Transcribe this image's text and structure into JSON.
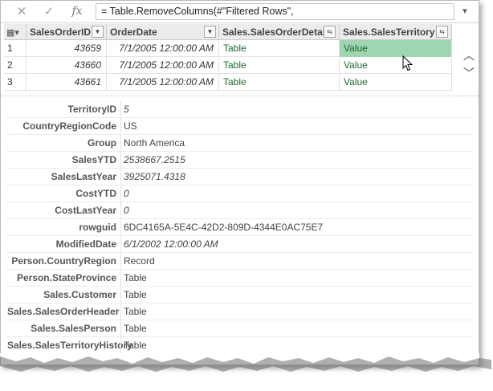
{
  "formula_bar": {
    "cancel_icon": "close-icon",
    "commit_icon": "check-icon",
    "fx_label": "fx",
    "formula": "= Table.RemoveColumns(#\"Filtered Rows\","
  },
  "grid": {
    "columns": [
      "SalesOrderID",
      "OrderDate",
      "Sales.SalesOrderDetail",
      "Sales.SalesTerritory"
    ],
    "rows": [
      {
        "num": "1",
        "id": "43659",
        "date": "7/1/2005 12:00:00 AM",
        "detail": "Table",
        "territory": "Value"
      },
      {
        "num": "2",
        "id": "43660",
        "date": "7/1/2005 12:00:00 AM",
        "detail": "Table",
        "territory": "Value"
      },
      {
        "num": "3",
        "id": "43661",
        "date": "7/1/2005 12:00:00 AM",
        "detail": "Table",
        "territory": "Value"
      }
    ]
  },
  "record": [
    {
      "label": "TerritoryID",
      "value": "5"
    },
    {
      "label": "CountryRegionCode",
      "value": "US"
    },
    {
      "label": "Group",
      "value": "North America"
    },
    {
      "label": "SalesYTD",
      "value": "2538667.2515"
    },
    {
      "label": "SalesLastYear",
      "value": "3925071.4318"
    },
    {
      "label": "CostYTD",
      "value": "0"
    },
    {
      "label": "CostLastYear",
      "value": "0"
    },
    {
      "label": "rowguid",
      "value": "6DC4165A-5E4C-42D2-809D-4344E0AC75E7"
    },
    {
      "label": "ModifiedDate",
      "value": "6/1/2002 12:00:00 AM"
    },
    {
      "label": "Person.CountryRegion",
      "value": "Record"
    },
    {
      "label": "Person.StateProvince",
      "value": "Table"
    },
    {
      "label": "Sales.Customer",
      "value": "Table"
    },
    {
      "label": "Sales.SalesOrderHeader",
      "value": "Table"
    },
    {
      "label": "Sales.SalesPerson",
      "value": "Table"
    },
    {
      "label": "Sales.SalesTerritoryHistory",
      "value": "Table"
    }
  ],
  "colors": {
    "link": "#1a6b2e",
    "selected": "#9fd5b0"
  }
}
